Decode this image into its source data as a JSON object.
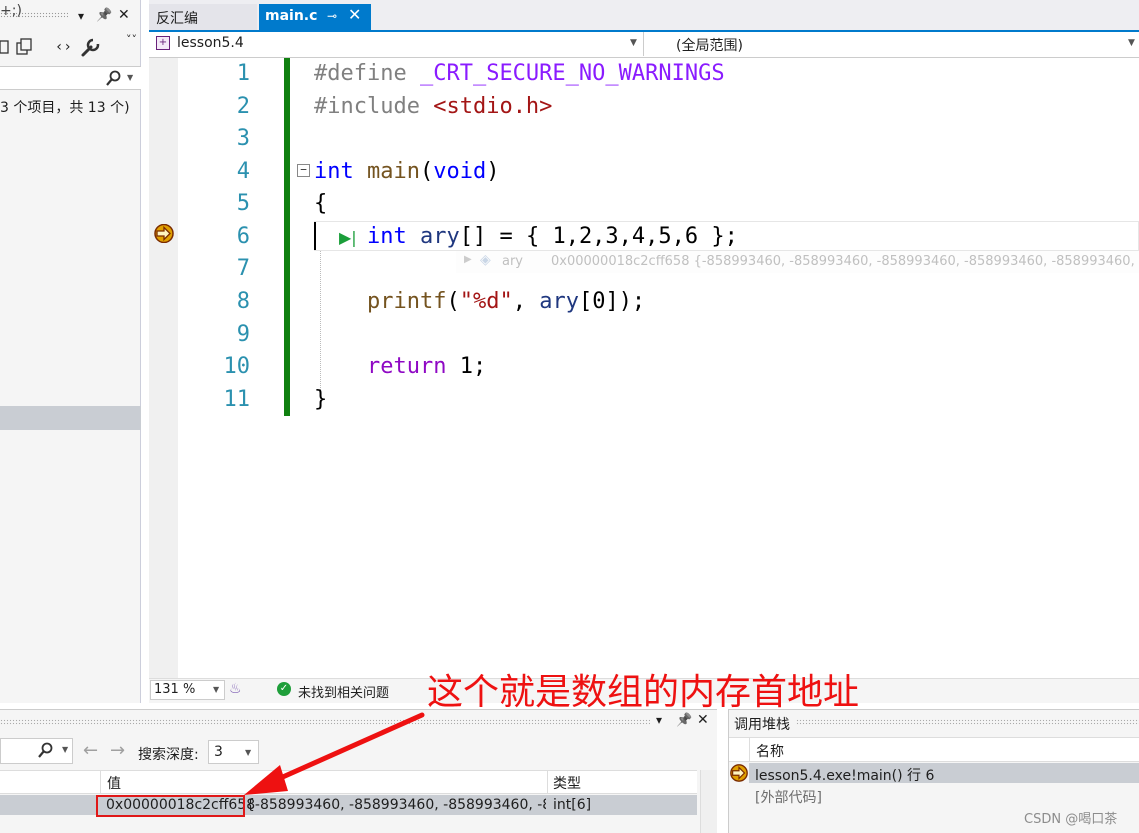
{
  "left_panel": {
    "toolbar_dropdown": "▾",
    "toolbar_pin": "📌",
    "toolbar_close": "✕",
    "tool_icons": [
      "copy-icon",
      "code-icon",
      "wrench-icon"
    ],
    "overflow": "˅˅",
    "search_partial": "+;)",
    "item_count": "3 个项目，共 13 个)"
  },
  "tabs": [
    {
      "label": "反汇编",
      "active": false
    },
    {
      "label": "main.c",
      "active": true
    }
  ],
  "tab_pin": "⊸",
  "tab_close": "✕",
  "nav": {
    "project": "lesson5.4",
    "scope": "(全局范围)"
  },
  "editor": {
    "line_numbers": [
      "1",
      "2",
      "3",
      "4",
      "5",
      "6",
      "7",
      "8",
      "9",
      "10",
      "11"
    ],
    "current_line": 6,
    "datatip": {
      "name": "ary",
      "value": "0x00000018c2cff658 {-858993460, -858993460, -858993460, -858993460, -858993460, -85"
    }
  },
  "editor_status": {
    "zoom": "131 %",
    "issues": "未找到相关问题"
  },
  "annotation": "这个就是数组的内存首地址",
  "watch": {
    "toolbar_dropdown": "▾",
    "toolbar_pin": "📌",
    "toolbar_close": "✕",
    "search_depth_label": "搜索深度:",
    "search_depth_value": "3",
    "columns": {
      "value": "值",
      "type": "类型"
    },
    "row": {
      "address": "0x00000018c2cff658",
      "values": "{-858993460, -858993460, -858993460, -858...",
      "type": "int[6]"
    }
  },
  "callstack": {
    "title": "调用堆栈",
    "column_name": "名称",
    "frames": [
      "lesson5.4.exe!main() 行 6",
      "[外部代码]"
    ]
  },
  "watermark": "CSDN @喝口茶",
  "colors": {
    "accent": "#007acc",
    "annotation": "#ee1111",
    "change_bar": "#108010",
    "keyword": "#0000ff",
    "line_number": "#2b91af"
  }
}
